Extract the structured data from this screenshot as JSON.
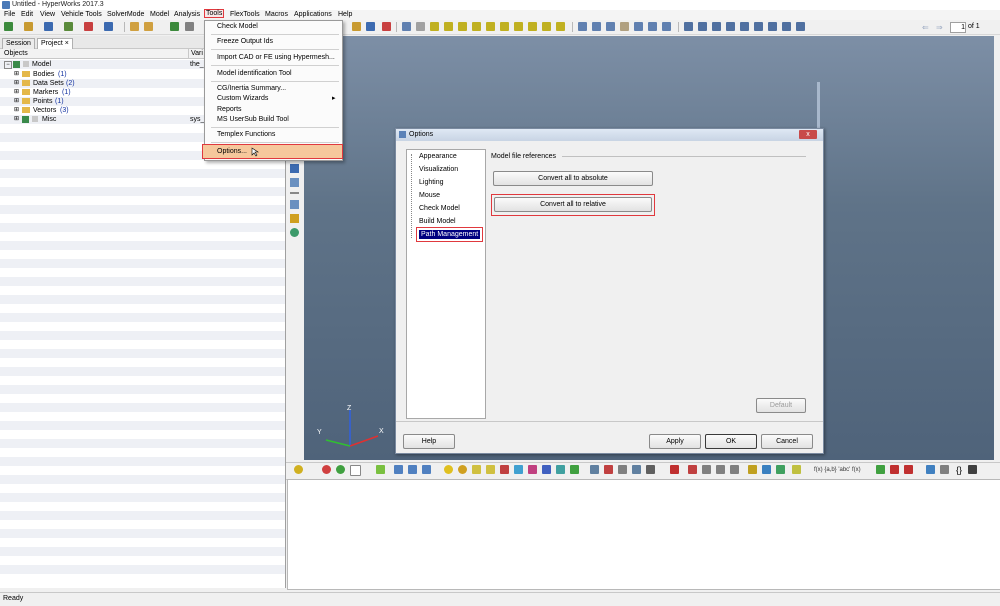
{
  "window": {
    "title": "Untitled - HyperWorks 2017.3"
  },
  "menubar": {
    "items": [
      "File",
      "Edit",
      "View",
      "Vehicle Tools",
      "SolverMode",
      "Model",
      "Analysis",
      "Tools",
      "FlexTools",
      "Macros",
      "Applications",
      "Help"
    ]
  },
  "page_nav": {
    "value": "1",
    "of": "of 1"
  },
  "browser": {
    "tabs": [
      "Session",
      "Project"
    ],
    "close_glyph": "×",
    "columns": [
      "Objects",
      "Vari"
    ],
    "tree": [
      {
        "label": "Model",
        "var": "the_"
      },
      {
        "label": "Bodies",
        "count": "(1)"
      },
      {
        "label": "Data Sets",
        "count": "(2)"
      },
      {
        "label": "Markers",
        "count": "(1)"
      },
      {
        "label": "Points",
        "count": "(1)"
      },
      {
        "label": "Vectors",
        "count": "(3)"
      },
      {
        "label": "Misc",
        "var": "sys_"
      }
    ]
  },
  "tools_menu": {
    "items": [
      "Check Model",
      "Freeze Output Ids",
      "Import CAD or FE using Hypermesh...",
      "Model identification Tool",
      "CG/Inertia Summary...",
      "Custom Wizards",
      "Reports",
      "MS UserSub Build Tool",
      "Templex Functions",
      "Options..."
    ],
    "submenu_arrow": "▸"
  },
  "options_dialog": {
    "title": "Options",
    "close_glyph": "x",
    "nav": [
      "Appearance",
      "Visualization",
      "Lighting",
      "Mouse",
      "Check Model",
      "Build Model",
      "Path Management"
    ],
    "group_label": "Model file references",
    "buttons": {
      "absolute": "Convert all to absolute",
      "relative": "Convert all to relative",
      "default": "Default",
      "help": "Help",
      "apply": "Apply",
      "ok": "OK",
      "cancel": "Cancel"
    }
  },
  "axes": {
    "x": "X",
    "y": "Y",
    "z": "Z"
  },
  "bottom_toolbar": {
    "fx_labels": "f(x)  {a,b}  'abc'  f(x)"
  },
  "status": {
    "text": "Ready"
  },
  "colors": {
    "highlight": "#e0393e",
    "selection": "#000080",
    "viewport_top": "#7d8fa6",
    "viewport_bottom": "#4f637a"
  }
}
